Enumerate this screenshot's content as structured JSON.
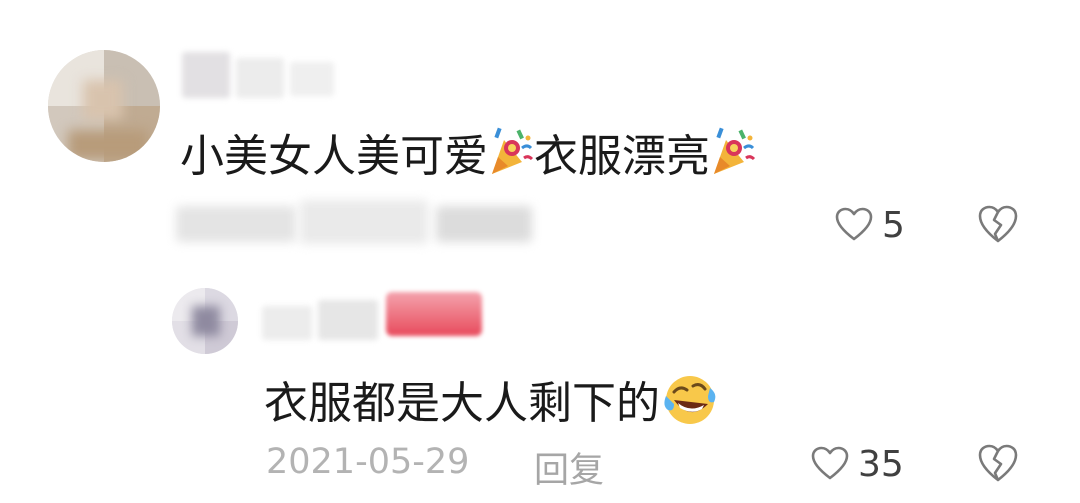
{
  "comments": [
    {
      "text": "小美女人美可爱",
      "text_part2": "衣服漂亮",
      "emoji_1": "party-popper",
      "emoji_2": "party-popper",
      "likes": "5",
      "like_icon": "heart-outline-icon",
      "dislike_icon": "broken-heart-icon"
    }
  ],
  "reply": {
    "text": "衣服都是大人剩下的",
    "emoji": "laughing-crying-face",
    "date": "2021-05-29",
    "reply_label": "回复",
    "likes": "35",
    "like_icon": "heart-outline-icon",
    "dislike_icon": "broken-heart-icon"
  },
  "colors": {
    "text_primary": "#1a1a1a",
    "meta_gray": "#b3b3b3",
    "icon_gray": "#7a7a7a",
    "badge_red": "#e84a5c"
  }
}
